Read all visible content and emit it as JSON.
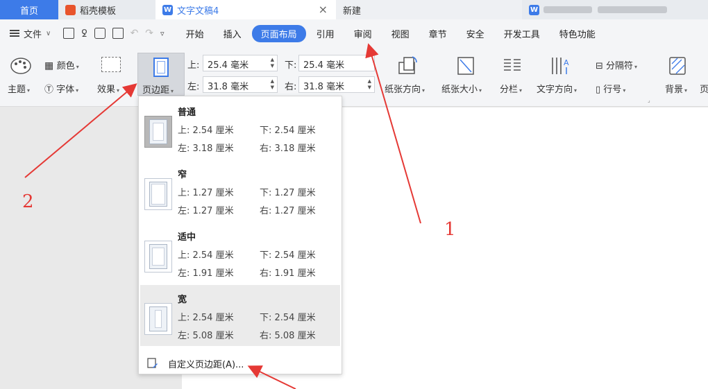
{
  "tabs": {
    "home": "首页",
    "template": "稻壳模板",
    "document": "文字文稿4",
    "new": "新建",
    "close_glyph": "×"
  },
  "menu": {
    "file": "文件",
    "items": [
      "开始",
      "插入",
      "页面布局",
      "引用",
      "审阅",
      "视图",
      "章节",
      "安全",
      "开发工具",
      "特色功能"
    ],
    "active": "页面布局"
  },
  "ribbon": {
    "theme": "主题",
    "color": "颜色",
    "font": "字体",
    "effect": "效果",
    "margins": "页边距",
    "top_label": "上:",
    "top_value": "25.4 毫米",
    "bottom_label": "下:",
    "bottom_value": "25.4 毫米",
    "left_label": "左:",
    "left_value": "31.8 毫米",
    "right_label": "右:",
    "right_value": "31.8 毫米",
    "orientation": "纸张方向",
    "paper_size": "纸张大小",
    "columns": "分栏",
    "text_direction": "文字方向",
    "separator": "分隔符",
    "line_number": "行号",
    "background": "背景",
    "border_partial": "页"
  },
  "margin_presets": [
    {
      "name": "普通",
      "top": "上: 2.54 厘米",
      "bottom": "下: 2.54 厘米",
      "left": "左: 3.18 厘米",
      "right": "右: 3.18 厘米"
    },
    {
      "name": "窄",
      "top": "上: 1.27 厘米",
      "bottom": "下: 1.27 厘米",
      "left": "左: 1.27 厘米",
      "right": "右: 1.27 厘米"
    },
    {
      "name": "适中",
      "top": "上: 2.54 厘米",
      "bottom": "下: 2.54 厘米",
      "left": "左: 1.91 厘米",
      "right": "右: 1.91 厘米"
    },
    {
      "name": "宽",
      "top": "上: 2.54 厘米",
      "bottom": "下: 2.54 厘米",
      "left": "左: 5.08 厘米",
      "right": "右: 5.08 厘米"
    }
  ],
  "custom_margins": "自定义页边距(A)...",
  "annotations": {
    "one": "1",
    "two": "2"
  },
  "colors": {
    "accent": "#3d7be8",
    "annotation": "#e53935"
  }
}
